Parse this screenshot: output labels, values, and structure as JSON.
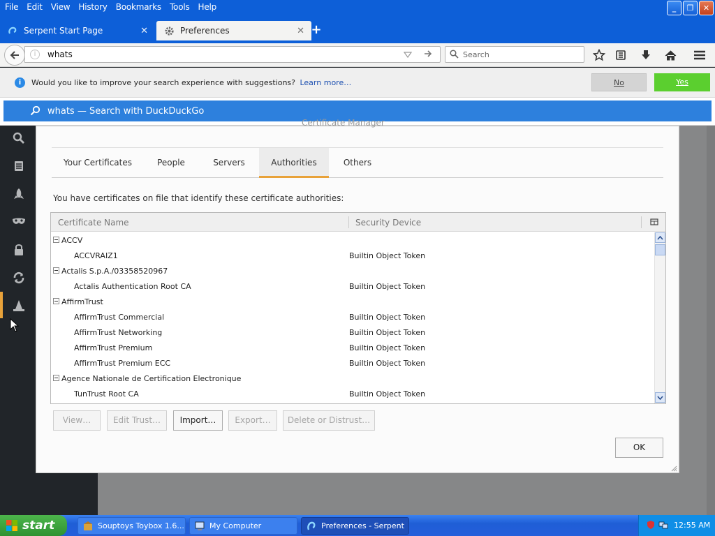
{
  "menubar": {
    "items": [
      "File",
      "Edit",
      "View",
      "History",
      "Bookmarks",
      "Tools",
      "Help"
    ]
  },
  "tabs": {
    "inactive_label": "Serpent Start Page",
    "active_label": "Preferences",
    "new_tab": "+"
  },
  "navbar": {
    "url_value": "whats",
    "search_placeholder": "Search"
  },
  "notification": {
    "message": "Would you like to improve your search experience with suggestions?",
    "link": "Learn more…",
    "no_label": "No",
    "yes_label": "Yes"
  },
  "suggestion": {
    "text": "whats — Search with DuckDuckGo"
  },
  "dialog": {
    "title": "Certificate Manager",
    "tabs": [
      "Your Certificates",
      "People",
      "Servers",
      "Authorities",
      "Others"
    ],
    "selected_tab": "Authorities",
    "intro": "You have certificates on file that identify these certificate authorities:",
    "columns": {
      "name": "Certificate Name",
      "device": "Security Device"
    },
    "rows": [
      {
        "type": "group",
        "name": "ACCV"
      },
      {
        "type": "cert",
        "name": "ACCVRAIZ1",
        "device": "Builtin Object Token"
      },
      {
        "type": "group",
        "name": "Actalis S.p.A./03358520967"
      },
      {
        "type": "cert",
        "name": "Actalis Authentication Root CA",
        "device": "Builtin Object Token"
      },
      {
        "type": "group",
        "name": "AffirmTrust"
      },
      {
        "type": "cert",
        "name": "AffirmTrust Commercial",
        "device": "Builtin Object Token"
      },
      {
        "type": "cert",
        "name": "AffirmTrust Networking",
        "device": "Builtin Object Token"
      },
      {
        "type": "cert",
        "name": "AffirmTrust Premium",
        "device": "Builtin Object Token"
      },
      {
        "type": "cert",
        "name": "AffirmTrust Premium ECC",
        "device": "Builtin Object Token"
      },
      {
        "type": "group",
        "name": "Agence Nationale de Certification Electronique"
      },
      {
        "type": "cert",
        "name": "TunTrust Root CA",
        "device": "Builtin Object Token"
      }
    ],
    "buttons": {
      "view": "View…",
      "edit_trust": "Edit Trust…",
      "import": "Import…",
      "export": "Export…",
      "delete": "Delete or Distrust…",
      "ok": "OK"
    }
  },
  "taskbar": {
    "start": "start",
    "tasks": [
      "Souptoys Toybox 1.6...",
      "My Computer",
      "Preferences - Serpent"
    ],
    "clock": "12:55 AM"
  },
  "colors": {
    "titlebar": "#0d5fd8",
    "accent_tab": "#e8a23a",
    "suggest_row": "#2d80dd",
    "yes_button": "#5bcf2f"
  }
}
